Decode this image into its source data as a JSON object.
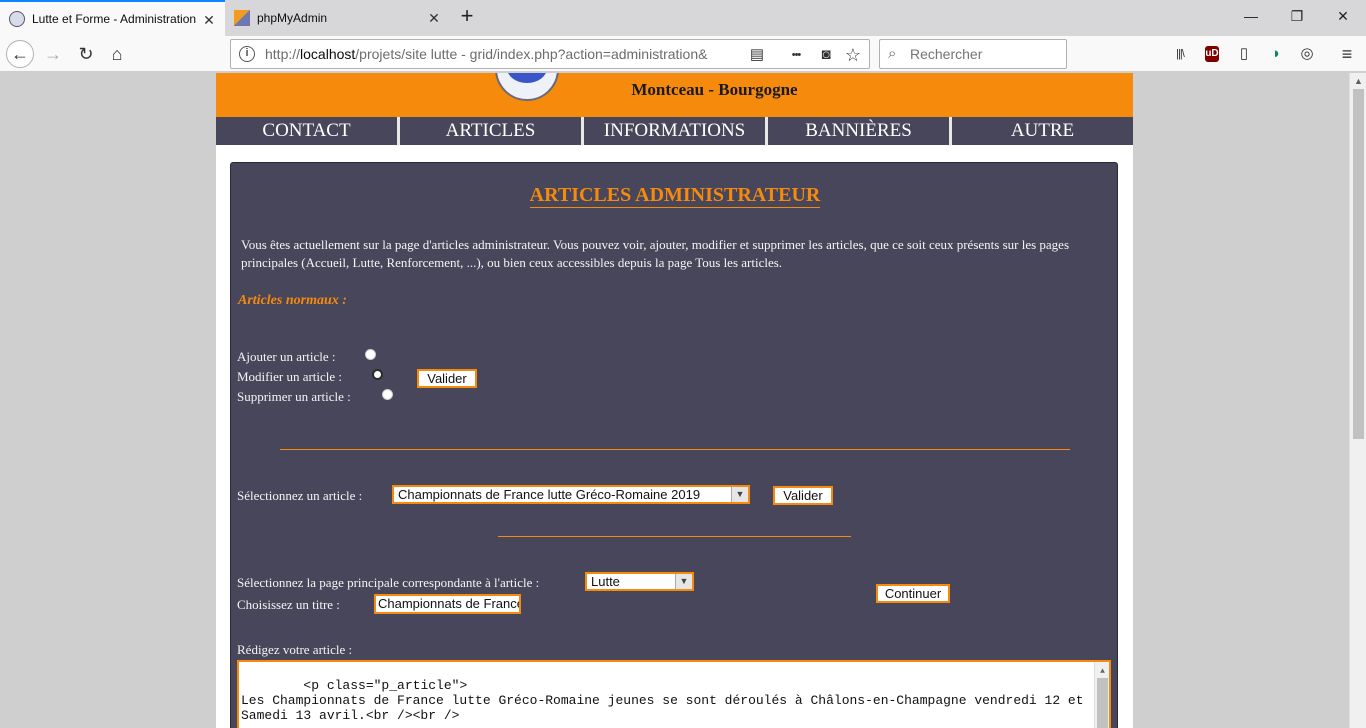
{
  "browser": {
    "tabs": [
      {
        "title": "Lutte et Forme - Administration",
        "active": true
      },
      {
        "title": "phpMyAdmin",
        "active": false
      }
    ],
    "url_prefix": "http://",
    "url_host": "localhost",
    "url_rest": "/projets/site lutte - grid/index.php?action=administration&",
    "search_placeholder": "Rechercher",
    "icons": {
      "back": "←",
      "forward": "→",
      "reload": "↻",
      "home": "⌂",
      "reader": "▤",
      "more": "•••",
      "pocket": "◙",
      "star": "☆",
      "search": "⌕",
      "library": "|||\\",
      "ublock": "uD",
      "sidebar": "▯",
      "sync": "◑",
      "addon": "◎",
      "menu": "≡",
      "minimize": "—",
      "restore": "❐",
      "close": "✕",
      "newtab": "+",
      "tab_close": "✕"
    }
  },
  "site": {
    "subtitle": "Montceau - Bourgogne",
    "menu": [
      "CONTACT",
      "ARTICLES",
      "INFORMATIONS",
      "BANNIÈRES",
      "AUTRE"
    ]
  },
  "admin": {
    "title": "ARTICLES ADMINISTRATEUR",
    "intro": "Vous êtes actuellement sur la page d'articles administrateur. Vous pouvez voir, ajouter, modifier et supprimer les articles, que ce soit ceux présents sur les pages principales (Accueil, Lutte, Renforcement, ...), ou bien ceux accessibles depuis la page Tous les articles.",
    "section_title": "Articles normaux :",
    "radios": [
      {
        "label": "Ajouter un article :",
        "checked": false
      },
      {
        "label": "Modifier un article :",
        "checked": true
      },
      {
        "label": "Supprimer un article :",
        "checked": false
      }
    ],
    "validate_label": "Valider",
    "select_article_label": "Sélectionnez un article :",
    "selected_article": "Championnats de France lutte Gréco-Romaine 2019",
    "select_page_label": "Sélectionnez la page principale correspondante à l'article :",
    "selected_page": "Lutte",
    "title_label": "Choisissez un titre :",
    "title_value": "Championnats de France",
    "continue_label": "Continuer",
    "write_label": "Rédigez votre article :",
    "article_body": "<p class=\"p_article\">\nLes Championnats de France lutte Gréco-Romaine jeunes se sont déroulés à Châlons-en-Champagne vendredi 12 et Samedi 13 avril.<br /><br />\n\nLes frères CASTELOA, chefs de file du club montcellien, avaient gagné leur sélection pour cette"
  }
}
